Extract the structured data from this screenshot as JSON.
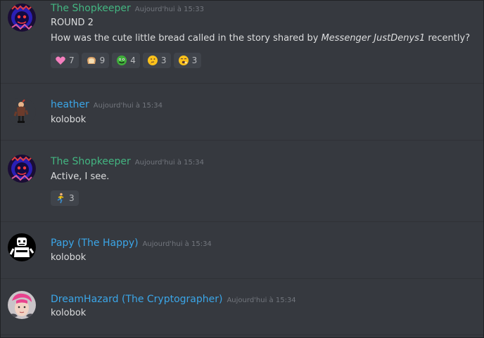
{
  "messages": [
    {
      "author": "The Shopkeeper",
      "timestamp": "Aujourd'hui à 15:33",
      "line1": "ROUND 2",
      "line2_before": "How was the cute little bread called in the story shared by ",
      "line2_italic": "Messenger JustDenys1",
      "line2_after": " recently?",
      "reactions": [
        {
          "emoji": "pink-heart",
          "count": "7"
        },
        {
          "emoji": "bread",
          "count": "9"
        },
        {
          "emoji": "green-face",
          "count": "4"
        },
        {
          "emoji": "thinking-face",
          "count": "3"
        },
        {
          "emoji": "yawning-face",
          "count": "3"
        }
      ]
    },
    {
      "author": "heather",
      "timestamp": "Aujourd'hui à 15:34",
      "text": "kolobok"
    },
    {
      "author": "The Shopkeeper",
      "timestamp": "Aujourd'hui à 15:34",
      "text": "Active, I see.",
      "reactions": [
        {
          "emoji": "running-person",
          "count": "3"
        }
      ]
    },
    {
      "author": "Papy (The Happy)",
      "timestamp": "Aujourd'hui à 15:34",
      "text": "kolobok"
    },
    {
      "author": "DreamHazard (The Cryptographer)",
      "timestamp": "Aujourd'hui à 15:34",
      "text": "kolobok"
    }
  ],
  "colors": {
    "background": "#36393f",
    "shopkeeper_name": "#43b581",
    "user_name": "#3ba6e8",
    "timestamp": "#72767d",
    "text": "#dcddde",
    "reaction_bg": "#40444b"
  }
}
